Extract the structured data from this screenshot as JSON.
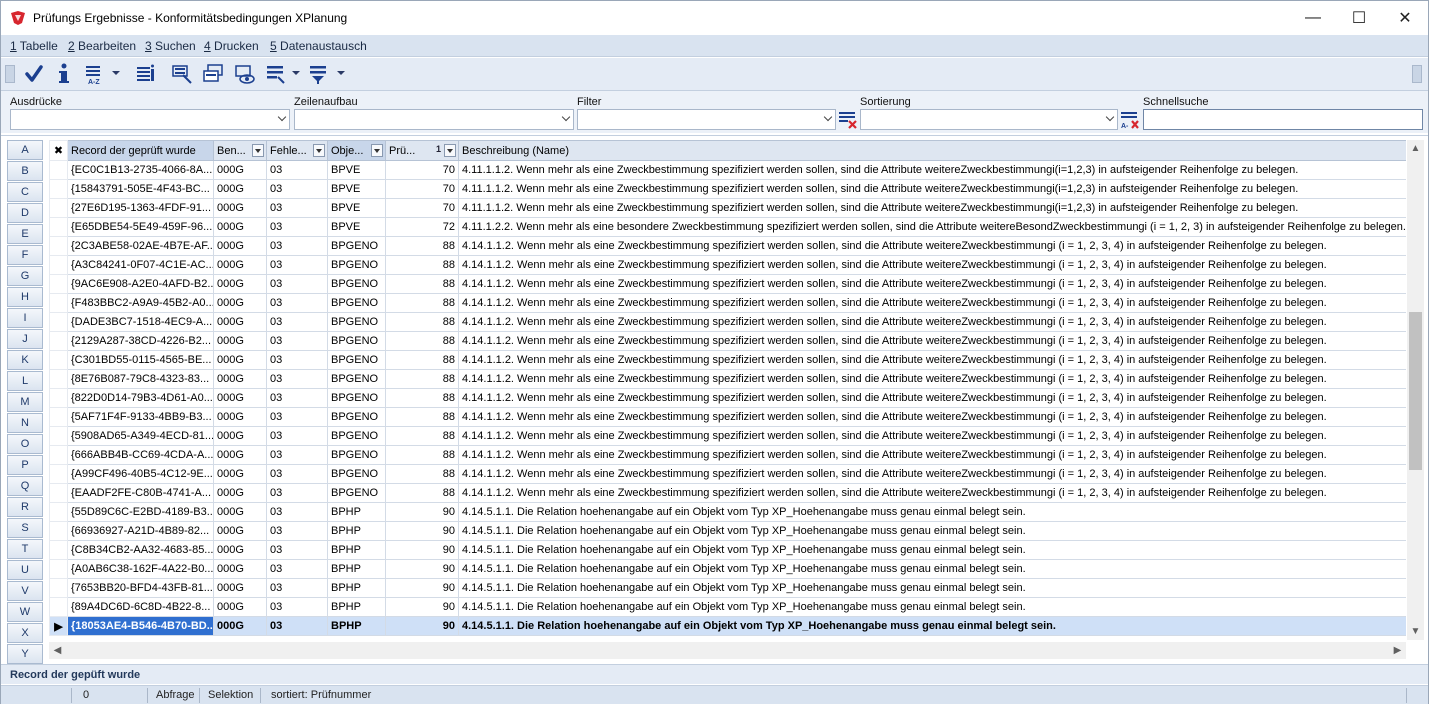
{
  "window": {
    "title_app": "Prüfungs Ergebnisse",
    "title_sep": " - ",
    "title_doc": "Konformitätsbedingungen XPlanung",
    "minimize": "—",
    "maximize": "☐",
    "close": "✕"
  },
  "menu": [
    {
      "key": "1",
      "label": " Tabelle"
    },
    {
      "key": "2",
      "label": " Bearbeiten"
    },
    {
      "key": "3",
      "label": " Suchen"
    },
    {
      "key": "4",
      "label": " Drucken"
    },
    {
      "key": "5",
      "label": " Datenaustausch"
    }
  ],
  "filters": {
    "ausdruecke": "Ausdrücke",
    "zeilenaufbau": "Zeilenaufbau",
    "filter": "Filter",
    "sortierung": "Sortierung",
    "schnellsuche": "Schnellsuche"
  },
  "letters": [
    "A",
    "B",
    "C",
    "D",
    "E",
    "F",
    "G",
    "H",
    "I",
    "J",
    "K",
    "L",
    "M",
    "N",
    "O",
    "P",
    "Q",
    "R",
    "S",
    "T",
    "U",
    "V",
    "W",
    "X",
    "Y"
  ],
  "grid": {
    "indicator_header": "✖",
    "columns": [
      "Record der geprüft wurde",
      "Ben...",
      "Fehle...",
      "Obje...",
      "Prü...",
      "Beschreibung (Name)"
    ],
    "sort_badge": "1",
    "rows": [
      [
        "{EC0C1B13-2735-4066-8A...",
        "000G",
        "03",
        "BPVE",
        "70",
        "4.11.1.1.2. Wenn mehr als eine Zweckbestimmung spezifiziert werden sollen, sind die Attribute weitereZweckbestimmungi(i=1,2,3) in aufsteigender Reihenfolge zu belegen."
      ],
      [
        "{15843791-505E-4F43-BC...",
        "000G",
        "03",
        "BPVE",
        "70",
        "4.11.1.1.2. Wenn mehr als eine Zweckbestimmung spezifiziert werden sollen, sind die Attribute weitereZweckbestimmungi(i=1,2,3) in aufsteigender Reihenfolge zu belegen."
      ],
      [
        "{27E6D195-1363-4FDF-91...",
        "000G",
        "03",
        "BPVE",
        "70",
        "4.11.1.1.2. Wenn mehr als eine Zweckbestimmung spezifiziert werden sollen, sind die Attribute weitereZweckbestimmungi(i=1,2,3) in aufsteigender Reihenfolge zu belegen."
      ],
      [
        "{E65DBE54-5E49-459F-96...",
        "000G",
        "03",
        "BPVE",
        "72",
        "4.11.1.2.2. Wenn mehr als eine besondere Zweckbestimmung spezifiziert werden sollen, sind die Attribute weitereBesondZweckbestimmungi (i = 1, 2, 3) in aufsteigender Reihenfolge zu belegen."
      ],
      [
        "{2C3ABE58-02AE-4B7E-AF...",
        "000G",
        "03",
        "BPGENO",
        "88",
        "4.14.1.1.2. Wenn mehr als eine Zweckbestimmung spezifiziert werden sollen, sind die Attribute weitereZweckbestimmungi (i = 1, 2, 3, 4) in aufsteigender Reihenfolge zu belegen."
      ],
      [
        "{A3C84241-0F07-4C1E-AC...",
        "000G",
        "03",
        "BPGENO",
        "88",
        "4.14.1.1.2. Wenn mehr als eine Zweckbestimmung spezifiziert werden sollen, sind die Attribute weitereZweckbestimmungi (i = 1, 2, 3, 4) in aufsteigender Reihenfolge zu belegen."
      ],
      [
        "{9AC6E908-A2E0-4AFD-B2...",
        "000G",
        "03",
        "BPGENO",
        "88",
        "4.14.1.1.2. Wenn mehr als eine Zweckbestimmung spezifiziert werden sollen, sind die Attribute weitereZweckbestimmungi (i = 1, 2, 3, 4) in aufsteigender Reihenfolge zu belegen."
      ],
      [
        "{F483BBC2-A9A9-45B2-A0...",
        "000G",
        "03",
        "BPGENO",
        "88",
        "4.14.1.1.2. Wenn mehr als eine Zweckbestimmung spezifiziert werden sollen, sind die Attribute weitereZweckbestimmungi (i = 1, 2, 3, 4) in aufsteigender Reihenfolge zu belegen."
      ],
      [
        "{DADE3BC7-1518-4EC9-A...",
        "000G",
        "03",
        "BPGENO",
        "88",
        "4.14.1.1.2. Wenn mehr als eine Zweckbestimmung spezifiziert werden sollen, sind die Attribute weitereZweckbestimmungi (i = 1, 2, 3, 4) in aufsteigender Reihenfolge zu belegen."
      ],
      [
        "{2129A287-38CD-4226-B2...",
        "000G",
        "03",
        "BPGENO",
        "88",
        "4.14.1.1.2. Wenn mehr als eine Zweckbestimmung spezifiziert werden sollen, sind die Attribute weitereZweckbestimmungi (i = 1, 2, 3, 4) in aufsteigender Reihenfolge zu belegen."
      ],
      [
        "{C301BD55-0115-4565-BE...",
        "000G",
        "03",
        "BPGENO",
        "88",
        "4.14.1.1.2. Wenn mehr als eine Zweckbestimmung spezifiziert werden sollen, sind die Attribute weitereZweckbestimmungi (i = 1, 2, 3, 4) in aufsteigender Reihenfolge zu belegen."
      ],
      [
        "{8E76B087-79C8-4323-83...",
        "000G",
        "03",
        "BPGENO",
        "88",
        "4.14.1.1.2. Wenn mehr als eine Zweckbestimmung spezifiziert werden sollen, sind die Attribute weitereZweckbestimmungi (i = 1, 2, 3, 4) in aufsteigender Reihenfolge zu belegen."
      ],
      [
        "{822D0D14-79B3-4D61-A0...",
        "000G",
        "03",
        "BPGENO",
        "88",
        "4.14.1.1.2. Wenn mehr als eine Zweckbestimmung spezifiziert werden sollen, sind die Attribute weitereZweckbestimmungi (i = 1, 2, 3, 4) in aufsteigender Reihenfolge zu belegen."
      ],
      [
        "{5AF71F4F-9133-4BB9-B3...",
        "000G",
        "03",
        "BPGENO",
        "88",
        "4.14.1.1.2. Wenn mehr als eine Zweckbestimmung spezifiziert werden sollen, sind die Attribute weitereZweckbestimmungi (i = 1, 2, 3, 4) in aufsteigender Reihenfolge zu belegen."
      ],
      [
        "{5908AD65-A349-4ECD-81...",
        "000G",
        "03",
        "BPGENO",
        "88",
        "4.14.1.1.2. Wenn mehr als eine Zweckbestimmung spezifiziert werden sollen, sind die Attribute weitereZweckbestimmungi (i = 1, 2, 3, 4) in aufsteigender Reihenfolge zu belegen."
      ],
      [
        "{666ABB4B-CC69-4CDA-A...",
        "000G",
        "03",
        "BPGENO",
        "88",
        "4.14.1.1.2. Wenn mehr als eine Zweckbestimmung spezifiziert werden sollen, sind die Attribute weitereZweckbestimmungi (i = 1, 2, 3, 4) in aufsteigender Reihenfolge zu belegen."
      ],
      [
        "{A99CF496-40B5-4C12-9E...",
        "000G",
        "03",
        "BPGENO",
        "88",
        "4.14.1.1.2. Wenn mehr als eine Zweckbestimmung spezifiziert werden sollen, sind die Attribute weitereZweckbestimmungi (i = 1, 2, 3, 4) in aufsteigender Reihenfolge zu belegen."
      ],
      [
        "{EAADF2FE-C80B-4741-A...",
        "000G",
        "03",
        "BPGENO",
        "88",
        "4.14.1.1.2. Wenn mehr als eine Zweckbestimmung spezifiziert werden sollen, sind die Attribute weitereZweckbestimmungi (i = 1, 2, 3, 4) in aufsteigender Reihenfolge zu belegen."
      ],
      [
        "{55D89C6C-E2BD-4189-B3...",
        "000G",
        "03",
        "BPHP",
        "90",
        "4.14.5.1.1. Die Relation hoehenangabe auf ein Objekt vom Typ XP_Hoehenangabe muss genau einmal belegt sein."
      ],
      [
        "{66936927-A21D-4B89-82...",
        "000G",
        "03",
        "BPHP",
        "90",
        "4.14.5.1.1. Die Relation hoehenangabe auf ein Objekt vom Typ XP_Hoehenangabe muss genau einmal belegt sein."
      ],
      [
        "{C8B34CB2-AA32-4683-85...",
        "000G",
        "03",
        "BPHP",
        "90",
        "4.14.5.1.1. Die Relation hoehenangabe auf ein Objekt vom Typ XP_Hoehenangabe muss genau einmal belegt sein."
      ],
      [
        "{A0AB6C38-162F-4A22-B0...",
        "000G",
        "03",
        "BPHP",
        "90",
        "4.14.5.1.1. Die Relation hoehenangabe auf ein Objekt vom Typ XP_Hoehenangabe muss genau einmal belegt sein."
      ],
      [
        "{7653BB20-BFD4-43FB-81...",
        "000G",
        "03",
        "BPHP",
        "90",
        "4.14.5.1.1. Die Relation hoehenangabe auf ein Objekt vom Typ XP_Hoehenangabe muss genau einmal belegt sein."
      ],
      [
        "{89A4DC6D-6C8D-4B22-8...",
        "000G",
        "03",
        "BPHP",
        "90",
        "4.14.5.1.1. Die Relation hoehenangabe auf ein Objekt vom Typ XP_Hoehenangabe muss genau einmal belegt sein."
      ],
      [
        "{18053AE4-B546-4B70-BD...",
        "000G",
        "03",
        "BPHP",
        "90",
        "4.14.5.1.1. Die Relation hoehenangabe auf ein Objekt vom Typ XP_Hoehenangabe muss genau einmal belegt sein."
      ]
    ],
    "selected_row": 24,
    "selected_marker": "▶"
  },
  "footer": {
    "label": "Record der gepüft wurde"
  },
  "status": {
    "count": "0",
    "abfrage": "Abfrage",
    "selektion": "Selektion",
    "sortiert": "sortiert: Prüfnummer"
  },
  "colors": {
    "accent": "#2f6fd0",
    "selected_row": "#cfe0f7",
    "chrome": "#d9e3f0"
  },
  "icons": [
    "checkmark-icon",
    "info-icon",
    "sort-az-icon",
    "record-info-icon",
    "query-icon",
    "copy-query-icon",
    "view-icon",
    "row-layout-icon",
    "filter-list-icon"
  ]
}
